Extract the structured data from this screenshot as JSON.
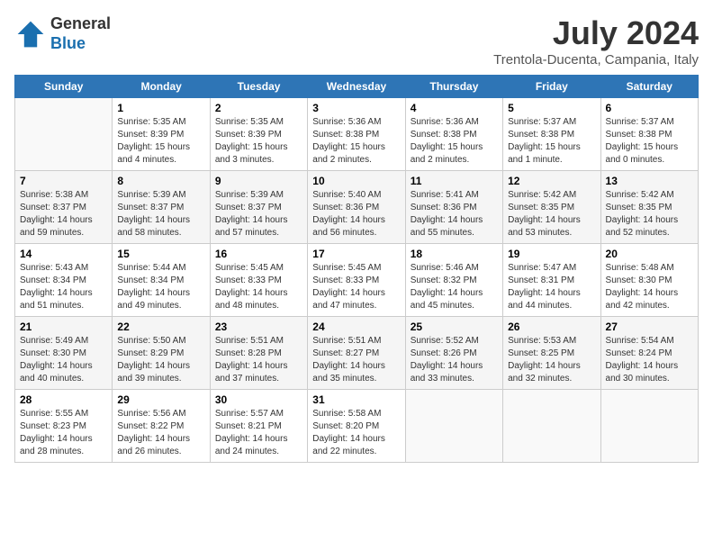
{
  "header": {
    "logo_general": "General",
    "logo_blue": "Blue",
    "month_year": "July 2024",
    "location": "Trentola-Ducenta, Campania, Italy"
  },
  "days_of_week": [
    "Sunday",
    "Monday",
    "Tuesday",
    "Wednesday",
    "Thursday",
    "Friday",
    "Saturday"
  ],
  "weeks": [
    [
      {
        "day": "",
        "detail": ""
      },
      {
        "day": "1",
        "detail": "Sunrise: 5:35 AM\nSunset: 8:39 PM\nDaylight: 15 hours\nand 4 minutes."
      },
      {
        "day": "2",
        "detail": "Sunrise: 5:35 AM\nSunset: 8:39 PM\nDaylight: 15 hours\nand 3 minutes."
      },
      {
        "day": "3",
        "detail": "Sunrise: 5:36 AM\nSunset: 8:38 PM\nDaylight: 15 hours\nand 2 minutes."
      },
      {
        "day": "4",
        "detail": "Sunrise: 5:36 AM\nSunset: 8:38 PM\nDaylight: 15 hours\nand 2 minutes."
      },
      {
        "day": "5",
        "detail": "Sunrise: 5:37 AM\nSunset: 8:38 PM\nDaylight: 15 hours\nand 1 minute."
      },
      {
        "day": "6",
        "detail": "Sunrise: 5:37 AM\nSunset: 8:38 PM\nDaylight: 15 hours\nand 0 minutes."
      }
    ],
    [
      {
        "day": "7",
        "detail": "Sunrise: 5:38 AM\nSunset: 8:37 PM\nDaylight: 14 hours\nand 59 minutes."
      },
      {
        "day": "8",
        "detail": "Sunrise: 5:39 AM\nSunset: 8:37 PM\nDaylight: 14 hours\nand 58 minutes."
      },
      {
        "day": "9",
        "detail": "Sunrise: 5:39 AM\nSunset: 8:37 PM\nDaylight: 14 hours\nand 57 minutes."
      },
      {
        "day": "10",
        "detail": "Sunrise: 5:40 AM\nSunset: 8:36 PM\nDaylight: 14 hours\nand 56 minutes."
      },
      {
        "day": "11",
        "detail": "Sunrise: 5:41 AM\nSunset: 8:36 PM\nDaylight: 14 hours\nand 55 minutes."
      },
      {
        "day": "12",
        "detail": "Sunrise: 5:42 AM\nSunset: 8:35 PM\nDaylight: 14 hours\nand 53 minutes."
      },
      {
        "day": "13",
        "detail": "Sunrise: 5:42 AM\nSunset: 8:35 PM\nDaylight: 14 hours\nand 52 minutes."
      }
    ],
    [
      {
        "day": "14",
        "detail": "Sunrise: 5:43 AM\nSunset: 8:34 PM\nDaylight: 14 hours\nand 51 minutes."
      },
      {
        "day": "15",
        "detail": "Sunrise: 5:44 AM\nSunset: 8:34 PM\nDaylight: 14 hours\nand 49 minutes."
      },
      {
        "day": "16",
        "detail": "Sunrise: 5:45 AM\nSunset: 8:33 PM\nDaylight: 14 hours\nand 48 minutes."
      },
      {
        "day": "17",
        "detail": "Sunrise: 5:45 AM\nSunset: 8:33 PM\nDaylight: 14 hours\nand 47 minutes."
      },
      {
        "day": "18",
        "detail": "Sunrise: 5:46 AM\nSunset: 8:32 PM\nDaylight: 14 hours\nand 45 minutes."
      },
      {
        "day": "19",
        "detail": "Sunrise: 5:47 AM\nSunset: 8:31 PM\nDaylight: 14 hours\nand 44 minutes."
      },
      {
        "day": "20",
        "detail": "Sunrise: 5:48 AM\nSunset: 8:30 PM\nDaylight: 14 hours\nand 42 minutes."
      }
    ],
    [
      {
        "day": "21",
        "detail": "Sunrise: 5:49 AM\nSunset: 8:30 PM\nDaylight: 14 hours\nand 40 minutes."
      },
      {
        "day": "22",
        "detail": "Sunrise: 5:50 AM\nSunset: 8:29 PM\nDaylight: 14 hours\nand 39 minutes."
      },
      {
        "day": "23",
        "detail": "Sunrise: 5:51 AM\nSunset: 8:28 PM\nDaylight: 14 hours\nand 37 minutes."
      },
      {
        "day": "24",
        "detail": "Sunrise: 5:51 AM\nSunset: 8:27 PM\nDaylight: 14 hours\nand 35 minutes."
      },
      {
        "day": "25",
        "detail": "Sunrise: 5:52 AM\nSunset: 8:26 PM\nDaylight: 14 hours\nand 33 minutes."
      },
      {
        "day": "26",
        "detail": "Sunrise: 5:53 AM\nSunset: 8:25 PM\nDaylight: 14 hours\nand 32 minutes."
      },
      {
        "day": "27",
        "detail": "Sunrise: 5:54 AM\nSunset: 8:24 PM\nDaylight: 14 hours\nand 30 minutes."
      }
    ],
    [
      {
        "day": "28",
        "detail": "Sunrise: 5:55 AM\nSunset: 8:23 PM\nDaylight: 14 hours\nand 28 minutes."
      },
      {
        "day": "29",
        "detail": "Sunrise: 5:56 AM\nSunset: 8:22 PM\nDaylight: 14 hours\nand 26 minutes."
      },
      {
        "day": "30",
        "detail": "Sunrise: 5:57 AM\nSunset: 8:21 PM\nDaylight: 14 hours\nand 24 minutes."
      },
      {
        "day": "31",
        "detail": "Sunrise: 5:58 AM\nSunset: 8:20 PM\nDaylight: 14 hours\nand 22 minutes."
      },
      {
        "day": "",
        "detail": ""
      },
      {
        "day": "",
        "detail": ""
      },
      {
        "day": "",
        "detail": ""
      }
    ]
  ]
}
